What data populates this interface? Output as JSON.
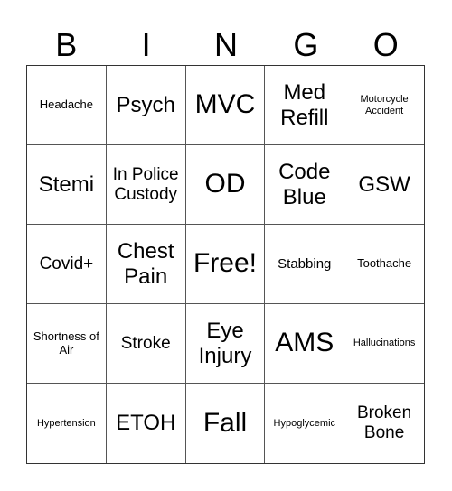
{
  "header": {
    "letters": [
      "B",
      "I",
      "N",
      "G",
      "O"
    ]
  },
  "card": {
    "rows": [
      [
        "Headache",
        "Psych",
        "MVC",
        "Med Refill",
        "Motorcycle Accident"
      ],
      [
        "Stemi",
        "In Police Custody",
        "OD",
        "Code Blue",
        "GSW"
      ],
      [
        "Covid+",
        "Chest Pain",
        "Free!",
        "Stabbing",
        "Toothache"
      ],
      [
        "Shortness of Air",
        "Stroke",
        "Eye Injury",
        "AMS",
        "Hallucinations"
      ],
      [
        "Hypertension",
        "ETOH",
        "Fall",
        "Hypoglycemic",
        "Broken Bone"
      ]
    ]
  }
}
